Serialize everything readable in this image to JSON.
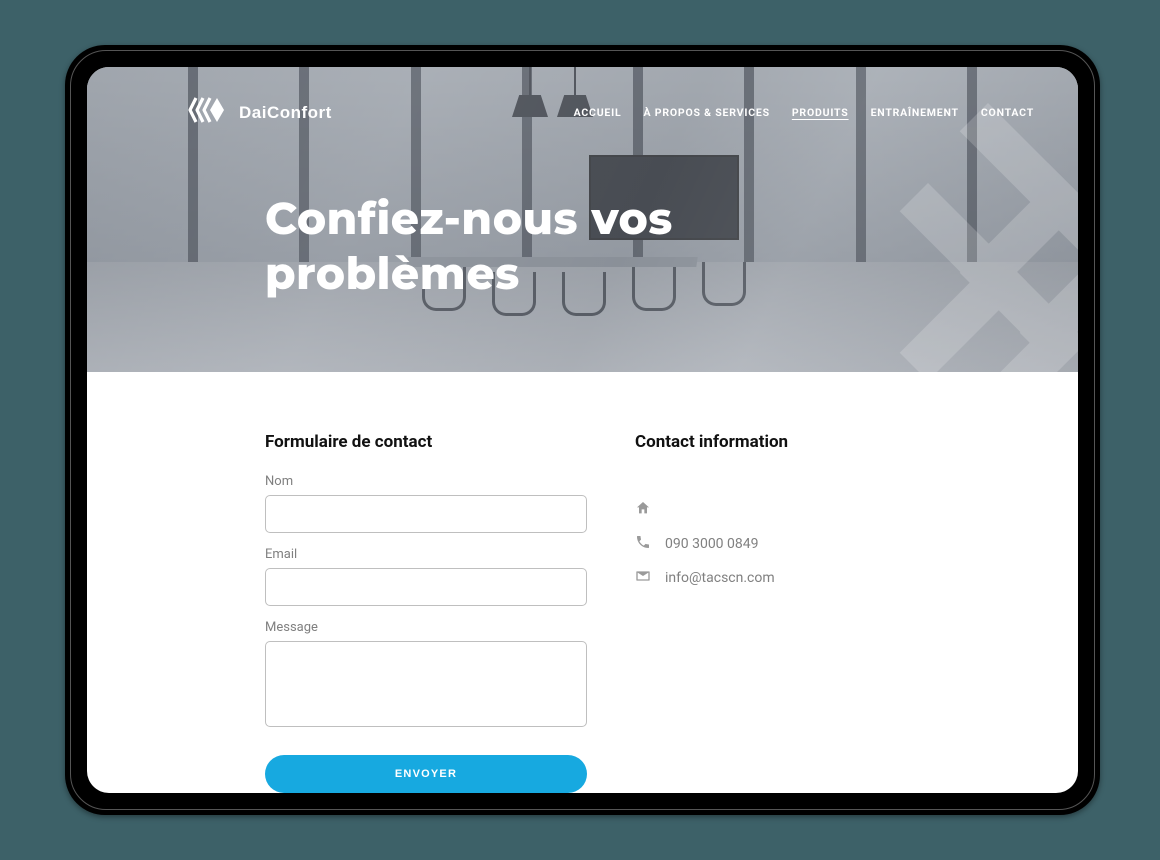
{
  "brand": {
    "name": "DaiConfort"
  },
  "nav": {
    "items": [
      {
        "label": "ACCUEIL",
        "active": false
      },
      {
        "label": "À PROPOS & SERVICES",
        "active": false
      },
      {
        "label": "PRODUITS",
        "active": true
      },
      {
        "label": "ENTRAÎNEMENT",
        "active": false
      },
      {
        "label": "CONTACT",
        "active": false
      }
    ]
  },
  "hero": {
    "title": "Confiez-nous vos problèmes"
  },
  "form": {
    "heading": "Formulaire de contact",
    "name_label": "Nom",
    "name_value": "",
    "email_label": "Email",
    "email_value": "",
    "message_label": "Message",
    "message_value": "",
    "submit_label": "ENVOYER"
  },
  "contact": {
    "heading": "Contact information",
    "address": "",
    "phone": "090 3000 0849",
    "email": "info@tacscn.com"
  },
  "colors": {
    "accent": "#17a9e0"
  }
}
